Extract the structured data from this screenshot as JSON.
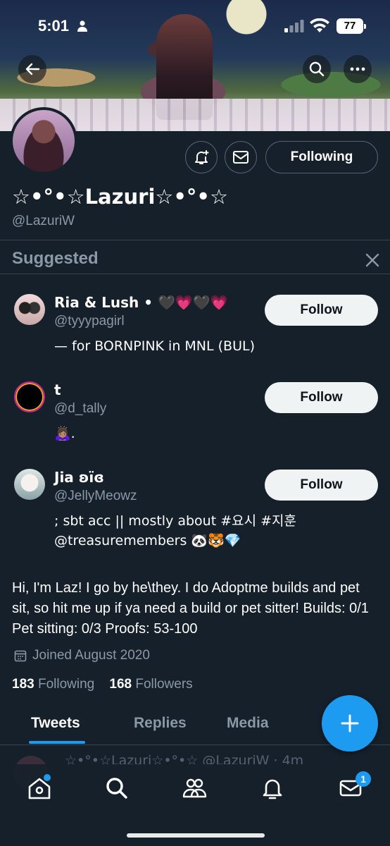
{
  "status_bar": {
    "time": "5:01",
    "battery": "77"
  },
  "profile": {
    "display_name": "☆•°•☆Lazuri☆•°•☆",
    "handle": "@LazuriW",
    "following_button": "Following",
    "bio": "Hi, I'm Laz! I go by he\\they. I do Adoptme builds and pet sit, so hit me up if ya need a build or pet sitter! Builds: 0/1 Pet sitting: 0/3 Proofs: 53-100",
    "joined": "Joined August 2020",
    "following_count": "183",
    "following_label": "Following",
    "followers_count": "168",
    "followers_label": "Followers"
  },
  "suggested": {
    "title": "Suggested",
    "users": [
      {
        "name": "Ria & Lush • 🖤💗🖤💗",
        "handle": "@tyyypagirl",
        "bio": "— for BORNPINK in MNL (BUL)",
        "button": "Follow"
      },
      {
        "name": "t",
        "handle": "@d_tally",
        "bio": "🙇🏽‍♀️.",
        "button": "Follow"
      },
      {
        "name": "Jia ʚïɞ",
        "handle": "@JellyMeowz",
        "bio": "; sbt acc || mostly about #요시 #지훈 @treasuremembers 🐼🐯💎",
        "button": "Follow"
      }
    ]
  },
  "tabs": [
    "Tweets",
    "Replies",
    "Media"
  ],
  "tweet_preview": "☆•°•☆Lazuri☆•°•☆ @LazuriW · 4m",
  "nav": {
    "messages_badge": "1"
  },
  "colors": {
    "background": "#15202b",
    "accent": "#1d9bf0",
    "muted": "#8b98a5"
  }
}
